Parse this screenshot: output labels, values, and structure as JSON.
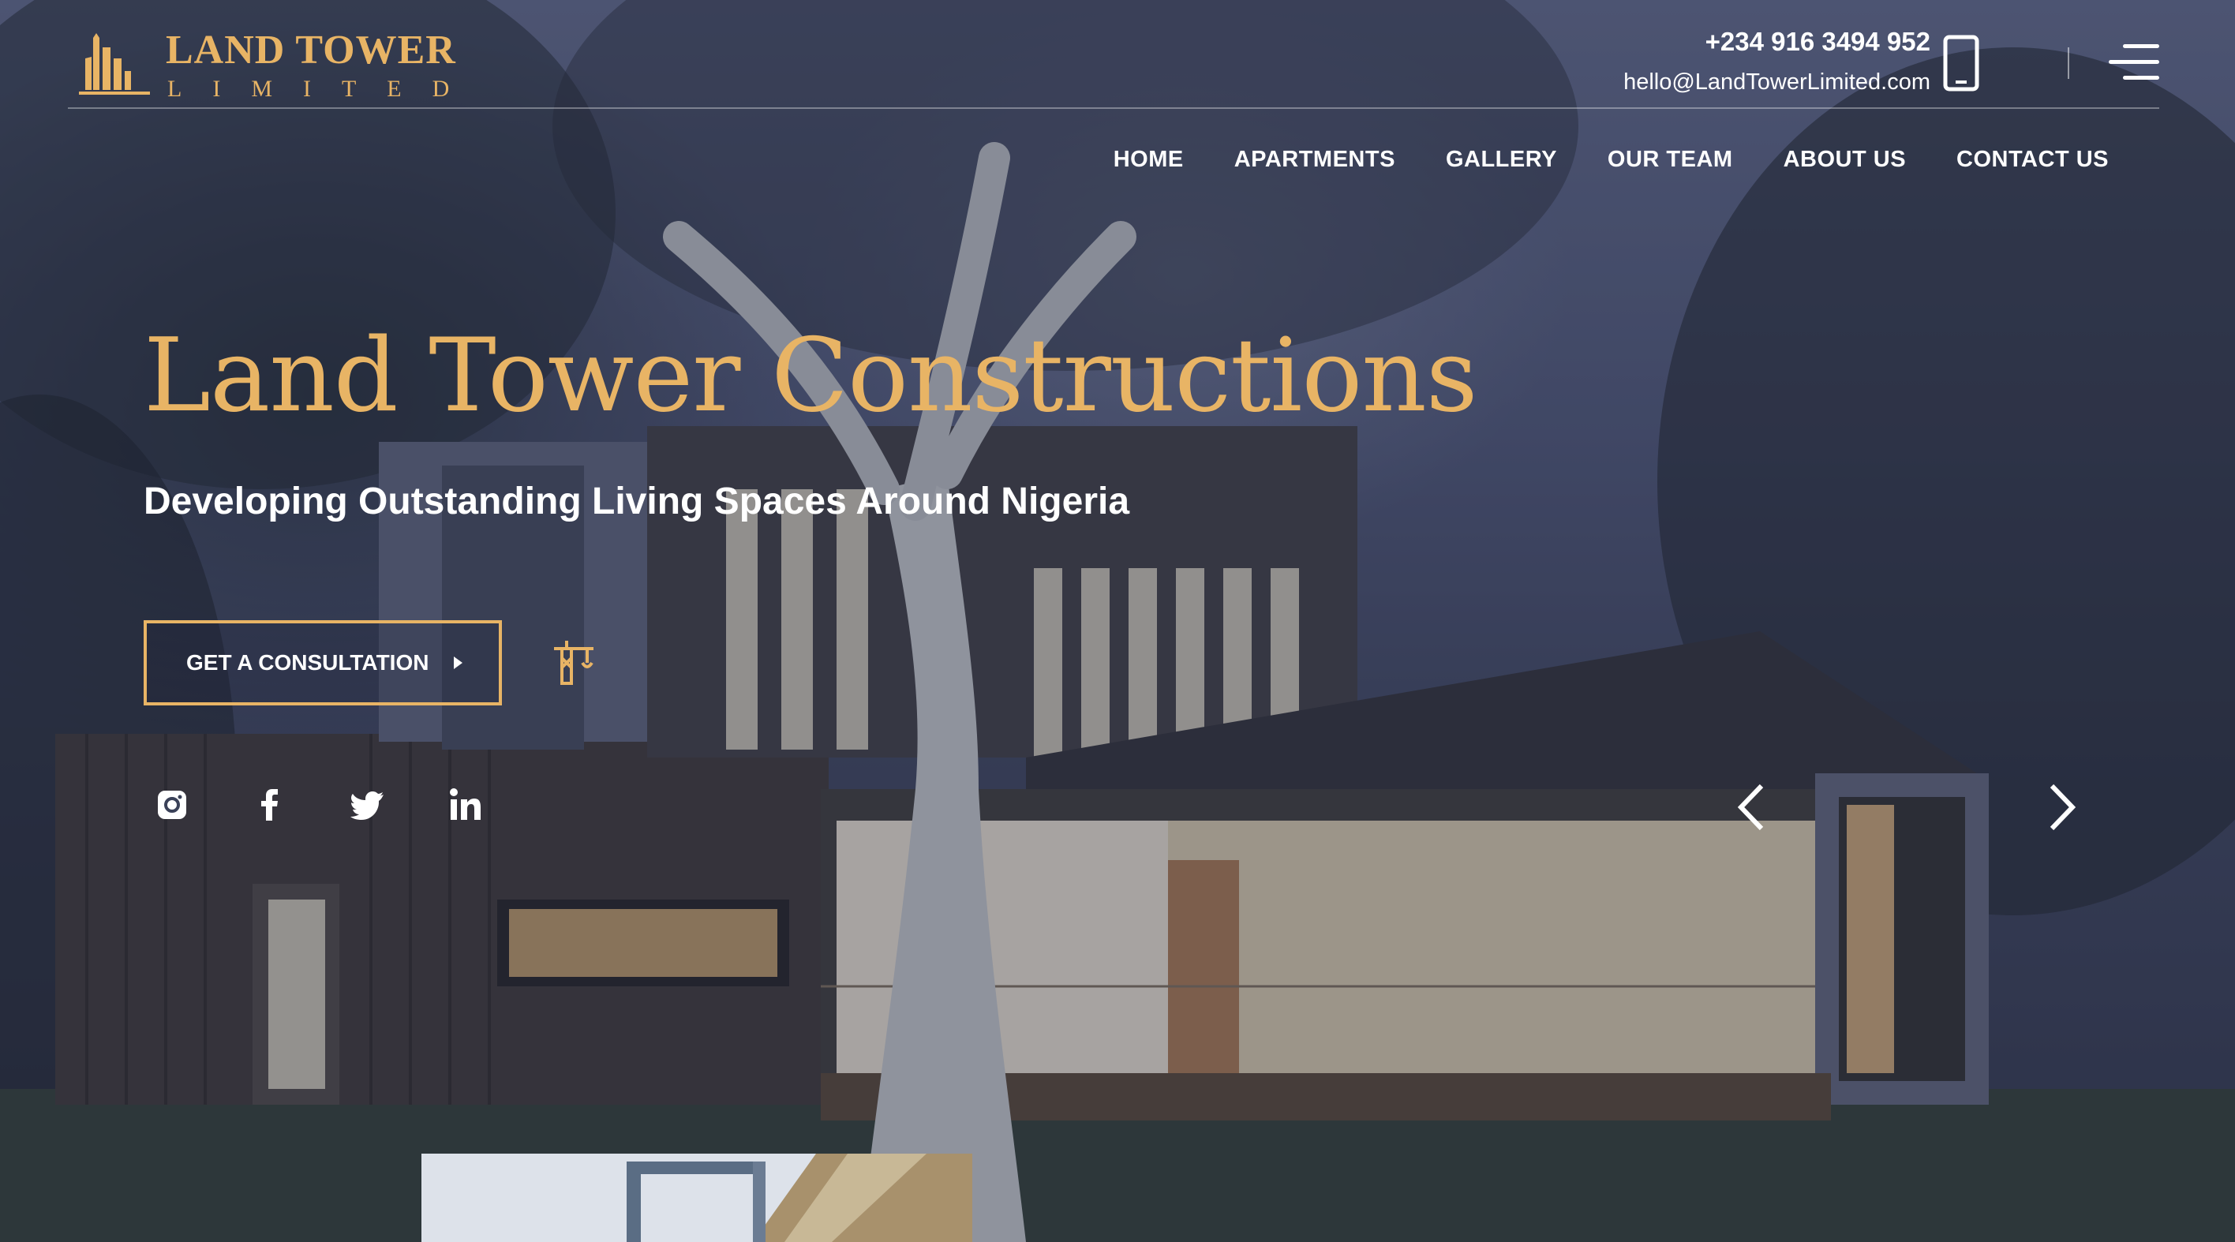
{
  "brand": {
    "name": "LAND TOWER",
    "subname": "LIMITED",
    "accent": "#e8b465"
  },
  "contact": {
    "phone": "+234 916 3494 952",
    "email": "hello@LandTowerLimited.com"
  },
  "nav": {
    "items": [
      {
        "label": "HOME"
      },
      {
        "label": "APARTMENTS"
      },
      {
        "label": "GALLERY"
      },
      {
        "label": "OUR TEAM"
      },
      {
        "label": "ABOUT US"
      },
      {
        "label": "CONTACT US"
      }
    ]
  },
  "hero": {
    "title": "Land Tower Constructions",
    "subtitle": "Developing Outstanding Living Spaces Around Nigeria",
    "cta_label": "GET A CONSULTATION"
  },
  "social": [
    "instagram-icon",
    "facebook-icon",
    "twitter-icon",
    "linkedin-icon"
  ],
  "icons": {
    "phone": "smartphone-icon",
    "menu": "hamburger-menu-icon",
    "crane": "crane-icon",
    "prev": "chevron-left-icon",
    "next": "chevron-right-icon"
  }
}
